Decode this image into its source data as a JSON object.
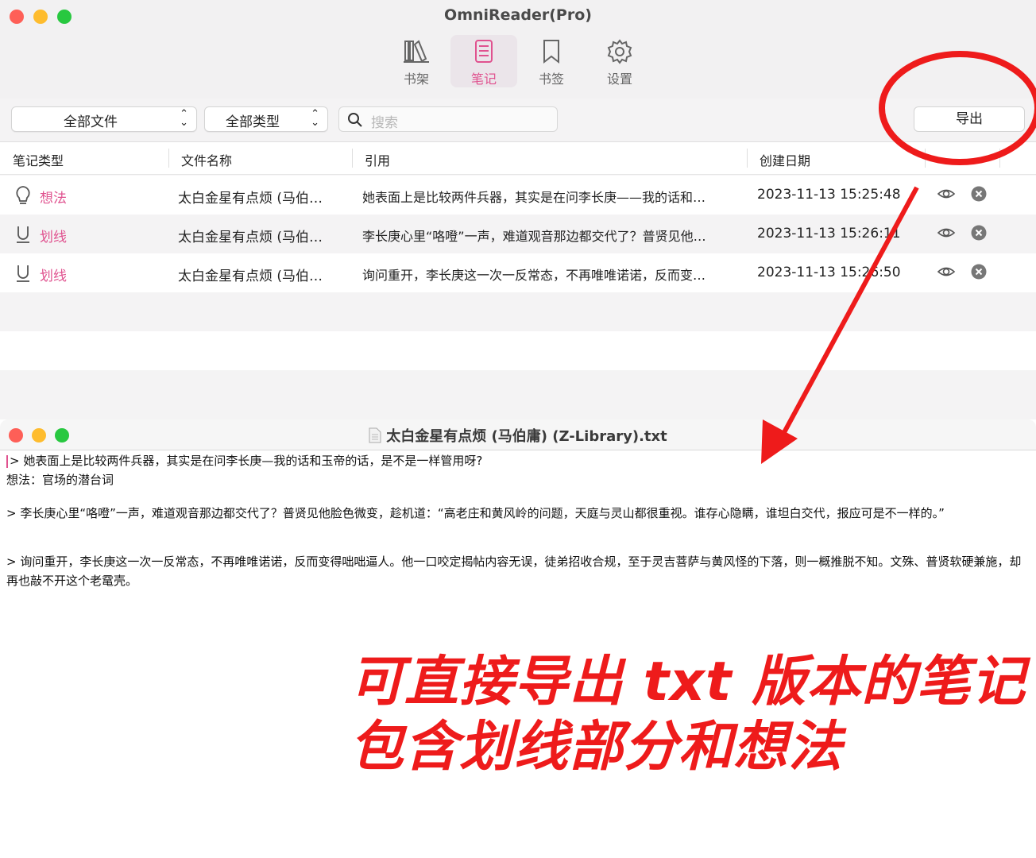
{
  "app": {
    "title": "OmniReader(Pro)",
    "toolbar": [
      {
        "label": "书架",
        "icon": "bookshelf-icon",
        "active": false
      },
      {
        "label": "笔记",
        "icon": "notes-icon",
        "active": true
      },
      {
        "label": "书签",
        "icon": "bookmark-icon",
        "active": false
      },
      {
        "label": "设置",
        "icon": "gear-icon",
        "active": false
      }
    ],
    "filters": {
      "file_select": "全部文件",
      "type_select": "全部类型",
      "search_placeholder": "搜索",
      "export_label": "导出"
    },
    "table": {
      "headers": [
        "笔记类型",
        "文件名称",
        "引用",
        "创建日期"
      ],
      "rows": [
        {
          "type": "想法",
          "type_icon": "lightbulb-icon",
          "file": "太白金星有点烦 (马伯…",
          "quote": "她表面上是比较两件兵器，其实是在问李长庚——我的话和…",
          "date": "2023-11-13 15:25:48"
        },
        {
          "type": "划线",
          "type_icon": "underline-icon",
          "file": "太白金星有点烦 (马伯…",
          "quote": "李长庚心里“咯噔”一声，难道观音那边都交代了？普贤见他…",
          "date": "2023-11-13 15:26:11"
        },
        {
          "type": "划线",
          "type_icon": "underline-icon",
          "file": "太白金星有点烦 (马伯…",
          "quote": "询问重开，李长庚这一次一反常态，不再唯唯诺诺，反而变…",
          "date": "2023-11-13 15:26:50"
        }
      ]
    }
  },
  "textedit": {
    "title": "太白金星有点烦 (马伯庸) (Z-Library).txt",
    "lines": [
      "> 她表面上是比较两件兵器，其实是在问李长庚—我的话和玉帝的话，是不是一样管用呀?",
      "想法：官场的潜台词",
      "> 李长庚心里“咯噔”一声，难道观音那边都交代了？普贤见他脸色微变，趁机道：“高老庄和黄风岭的问题，天庭与灵山都很重视。谁存心隐瞒，谁坦白交代，报应可是不一样的。”",
      "> 询问重开，李长庚这一次一反常态，不再唯唯诺诺，反而变得咄咄逼人。他一口咬定揭帖内容无误，徒弟招收合规，至于灵吉菩萨与黄风怪的下落，则一概推脱不知。文殊、普贤软硬兼施，却再也敲不开这个老鼋壳。"
    ]
  },
  "caption": {
    "line1": "可直接导出 txt 版本的笔记",
    "line2": "包含划线部分和想法"
  },
  "colors": {
    "accent": "#e0528f",
    "annotation_red": "#ee1b1b"
  }
}
